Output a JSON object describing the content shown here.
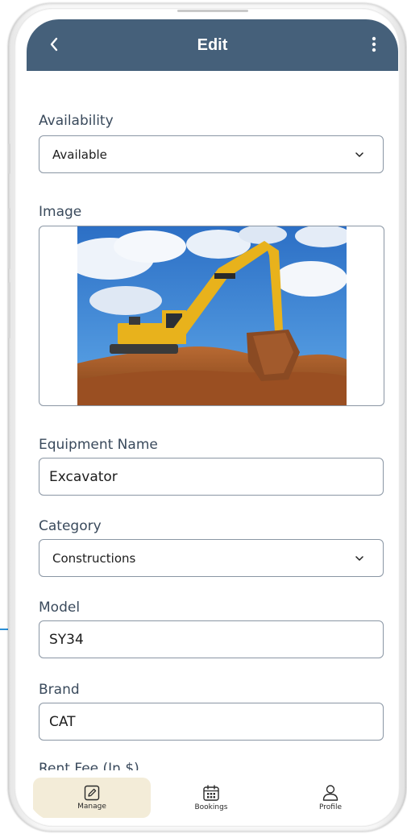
{
  "header": {
    "title": "Edit",
    "back_icon": "chevron-left-icon",
    "menu_icon": "kebab-menu-icon",
    "background": "#45607a"
  },
  "form": {
    "availability": {
      "label": "Availability",
      "value": "Available"
    },
    "image": {
      "label": "Image",
      "alt": "Yellow CAT excavator on a dirt mound under a blue sky"
    },
    "equipment_name": {
      "label": "Equipment Name",
      "value": "Excavator"
    },
    "category": {
      "label": "Category",
      "value": "Constructions"
    },
    "model": {
      "label": "Model",
      "value": "SY34"
    },
    "brand": {
      "label": "Brand",
      "value": "CAT"
    },
    "rent_fee": {
      "label": "Rent Fee (In $)"
    }
  },
  "bottom_nav": {
    "items": [
      {
        "label": "Manage",
        "icon": "edit-icon",
        "active": true
      },
      {
        "label": "Bookings",
        "icon": "calendar-icon",
        "active": false
      },
      {
        "label": "Profile",
        "icon": "user-icon",
        "active": false
      }
    ],
    "active_color": "#f3ecd8"
  }
}
